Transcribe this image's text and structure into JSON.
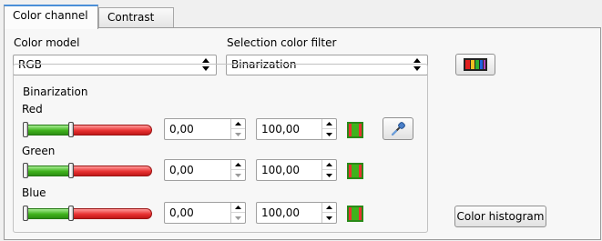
{
  "tabs": [
    {
      "label": "Color channel",
      "active": true
    },
    {
      "label": "Contrast",
      "active": false
    }
  ],
  "color_model": {
    "label": "Color model",
    "value": "RGB"
  },
  "selection_filter": {
    "label": "Selection color filter",
    "value": "Binarization"
  },
  "palette_button": {
    "icon": "color-palette-icon"
  },
  "binarization": {
    "title": "Binarization",
    "channels": [
      {
        "name": "Red",
        "min": "0,00",
        "max": "100,00",
        "slider_low_fraction": 0.0,
        "slider_high_fraction": 0.36
      },
      {
        "name": "Green",
        "min": "0,00",
        "max": "100,00",
        "slider_low_fraction": 0.0,
        "slider_high_fraction": 0.36
      },
      {
        "name": "Blue",
        "min": "0,00",
        "max": "100,00",
        "slider_low_fraction": 0.0,
        "slider_high_fraction": 0.36
      }
    ]
  },
  "eyedropper": {
    "icon": "eyedropper-icon"
  },
  "histogram_button": {
    "label": "Color histogram"
  },
  "colors": {
    "active_tab_accent": "#4a8fd8",
    "in_range": "#3fb21c",
    "out_of_range": "#e83232"
  }
}
